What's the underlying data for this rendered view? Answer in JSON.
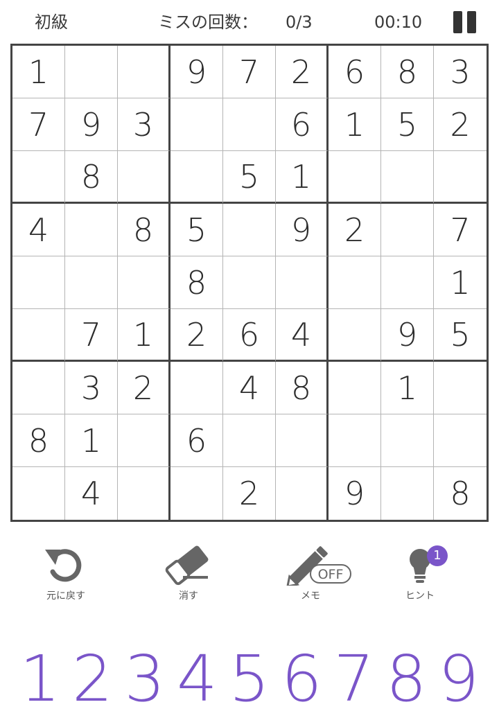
{
  "header": {
    "difficulty": "初級",
    "mistakes_label": "ミスの回数：",
    "mistakes_value": "0/3",
    "timer": "00:10"
  },
  "board": [
    [
      "1",
      "",
      "",
      "9",
      "7",
      "2",
      "6",
      "8",
      "3"
    ],
    [
      "7",
      "9",
      "3",
      "",
      "",
      "6",
      "1",
      "5",
      "2"
    ],
    [
      "",
      "8",
      "",
      "",
      "5",
      "1",
      "",
      "",
      ""
    ],
    [
      "4",
      "",
      "8",
      "5",
      "",
      "9",
      "2",
      "",
      "7"
    ],
    [
      "",
      "",
      "",
      "8",
      "",
      "",
      "",
      "",
      "1"
    ],
    [
      "",
      "7",
      "1",
      "2",
      "6",
      "4",
      "",
      "9",
      "5"
    ],
    [
      "",
      "3",
      "2",
      "",
      "4",
      "8",
      "",
      "1",
      ""
    ],
    [
      "8",
      "1",
      "",
      "6",
      "",
      "",
      "",
      "",
      ""
    ],
    [
      "",
      "4",
      "",
      "",
      "2",
      "",
      "9",
      "",
      "8"
    ]
  ],
  "tools": {
    "undo": {
      "label": "元に戻す",
      "icon": "undo-icon"
    },
    "erase": {
      "label": "消す",
      "icon": "eraser-icon"
    },
    "memo": {
      "label": "メモ",
      "icon": "pencil-icon",
      "state": "OFF"
    },
    "hint": {
      "label": "ヒント",
      "icon": "lightbulb-icon",
      "count": "1"
    }
  },
  "numpad": [
    "1",
    "2",
    "3",
    "4",
    "5",
    "6",
    "7",
    "8",
    "9"
  ],
  "colors": {
    "accent": "#7a55c9",
    "grid_thick": "#444444",
    "grid_thin": "#b4b4b4",
    "icon": "#666666"
  }
}
